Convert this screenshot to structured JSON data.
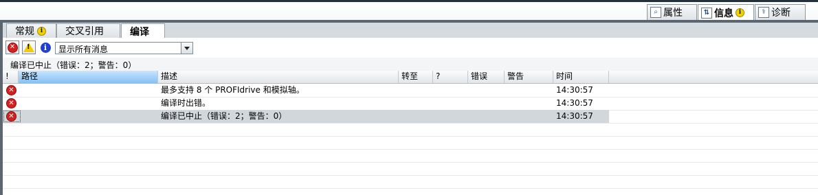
{
  "panel_tabs": [
    {
      "label": "属性",
      "icon": "properties-icon",
      "active": false
    },
    {
      "label": "信息",
      "icon": "info-flow-icon",
      "active": true,
      "badge": "i"
    },
    {
      "label": "诊断",
      "icon": "diagnostics-icon",
      "active": false
    }
  ],
  "sub_tabs": [
    {
      "label": "常规",
      "badge": "i",
      "active": false
    },
    {
      "label": "交叉引用",
      "active": false
    },
    {
      "label": "编译",
      "active": true
    }
  ],
  "toolbar": {
    "error_filter_icon": "error-icon",
    "warning_filter_icon": "warning-icon",
    "info_filter_icon": "info-icon",
    "filter_selected": "显示所有消息"
  },
  "status_text": "编译已中止（错误：2；警告：0）",
  "table": {
    "columns": [
      "!",
      "路径",
      "描述",
      "转至",
      "?",
      "错误",
      "警告",
      "时间"
    ],
    "rows": [
      {
        "icon": "error-icon",
        "path": "",
        "description": "最多支持 8 个 PROFIdrive 和模拟轴。",
        "goto": "",
        "help": "",
        "errors": "",
        "warnings": "",
        "time": "14:30:57",
        "selected": false
      },
      {
        "icon": "error-icon",
        "path": "",
        "description": "编译时出错。",
        "goto": "",
        "help": "",
        "errors": "",
        "warnings": "",
        "time": "14:30:57",
        "selected": false
      },
      {
        "icon": "error-icon",
        "path": "",
        "description": "编译已中止（错误：2；警告：0）",
        "goto": "",
        "help": "",
        "errors": "",
        "warnings": "",
        "time": "14:30:57",
        "selected": true
      }
    ]
  },
  "colors": {
    "error": "#d62020",
    "warning": "#f2cc00",
    "info": "#1f3fd6",
    "header_selected": "#86c1f2"
  }
}
